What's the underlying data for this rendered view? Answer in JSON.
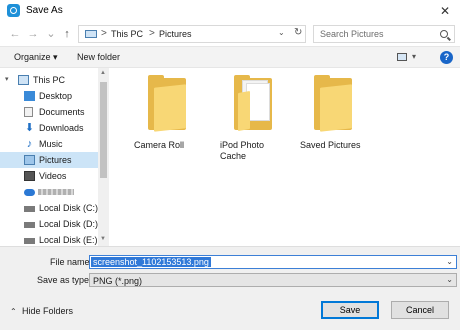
{
  "window": {
    "title": "Save As",
    "close_glyph": "✕"
  },
  "address": {
    "back_glyph": "←",
    "forward_glyph": "→",
    "recent_glyph": "⌄",
    "up_glyph": "↑",
    "crumbs": [
      "This PC",
      "Pictures"
    ],
    "crumb_sep": ">",
    "dropdown_glyph": "⌄",
    "refresh_glyph": "↻"
  },
  "search": {
    "placeholder": "Search Pictures"
  },
  "toolbar": {
    "organize_label": "Organize ▾",
    "new_folder_label": "New folder",
    "view_dd_glyph": "▾",
    "help_glyph": "?"
  },
  "nav": {
    "items": [
      {
        "label": "This PC",
        "icon": "pc-icon"
      },
      {
        "label": "Desktop",
        "icon": "desktop-icon"
      },
      {
        "label": "Documents",
        "icon": "documents-icon"
      },
      {
        "label": "Downloads",
        "icon": "downloads-icon"
      },
      {
        "label": "Music",
        "icon": "music-icon"
      },
      {
        "label": "Pictures",
        "icon": "pictures-icon",
        "selected": true
      },
      {
        "label": "Videos",
        "icon": "videos-icon"
      },
      {
        "label": "",
        "icon": "cloud-drive-icon"
      },
      {
        "label": "Local Disk (C:)",
        "icon": "drive-icon"
      },
      {
        "label": "Local Disk (D:)",
        "icon": "drive-icon"
      },
      {
        "label": "Local Disk (E:)",
        "icon": "drive-icon"
      }
    ],
    "expander_glyph": "▾"
  },
  "folders": [
    {
      "label": "Camera Roll",
      "icon": "folder-icon"
    },
    {
      "label": "iPod Photo Cache",
      "icon": "folder-with-files-icon"
    },
    {
      "label": "Saved Pictures",
      "icon": "folder-icon"
    }
  ],
  "form": {
    "filename_label": "File name:",
    "filename_value": "screenshot_1102153513.png",
    "filetype_label": "Save as type:",
    "filetype_value": "PNG (*.png)",
    "dropdown_glyph": "⌄"
  },
  "footer": {
    "hide_chevron": "⌃",
    "hide_folders_label": "Hide Folders",
    "save_label": "Save",
    "cancel_label": "Cancel"
  },
  "colors": {
    "accent": "#0078d7",
    "selection": "#cce4f7",
    "folder": "#f8d775",
    "help": "#1a66c8"
  }
}
